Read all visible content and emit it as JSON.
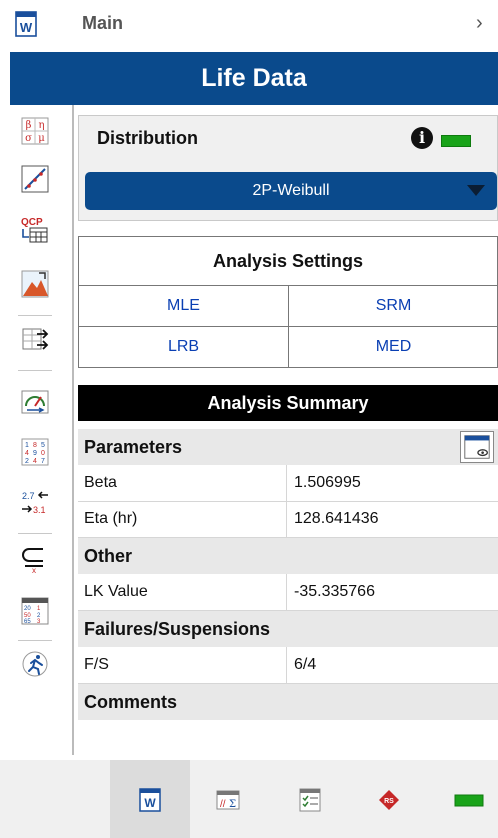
{
  "topbar": {
    "title": "Main",
    "arrow": "›",
    "icon": "weibull-folio-icon"
  },
  "header": {
    "title": "Life Data",
    "color": "#0a4a8c"
  },
  "toolbar": {
    "icons": [
      "parameters-icon",
      "plot-icon",
      "qcp-icon",
      "mountain-icon",
      "data-transfer-icon",
      "gauge-icon",
      "numeric-grid-icon",
      "convert-icon",
      "subset-icon",
      "calendar-grid-icon",
      "run-icon"
    ]
  },
  "distribution": {
    "label": "Distribution",
    "info_icon": "i",
    "selected": "2P-Weibull",
    "status_color": "#19a319"
  },
  "analysis_settings": {
    "title": "Analysis Settings",
    "rows": [
      [
        "MLE",
        "SRM"
      ],
      [
        "LRB",
        "MED"
      ]
    ]
  },
  "analysis_summary": {
    "title": "Analysis Summary",
    "parameters": {
      "label": "Parameters",
      "rows": [
        {
          "key": "Beta",
          "value": "1.506995"
        },
        {
          "key": "Eta (hr)",
          "value": "128.641436"
        }
      ]
    },
    "other": {
      "label": "Other",
      "rows": [
        {
          "key": "LK Value",
          "value": "-35.335766"
        }
      ]
    },
    "failures": {
      "label": "Failures/Suspensions",
      "rows": [
        {
          "key": "F/S",
          "value": "6/4"
        }
      ]
    },
    "comments": {
      "label": "Comments"
    }
  },
  "bottombar": {
    "icons": [
      "folio-icon",
      "calculation-icon",
      "checklist-icon",
      "rs-logo-icon",
      "status-indicator-icon"
    ]
  }
}
